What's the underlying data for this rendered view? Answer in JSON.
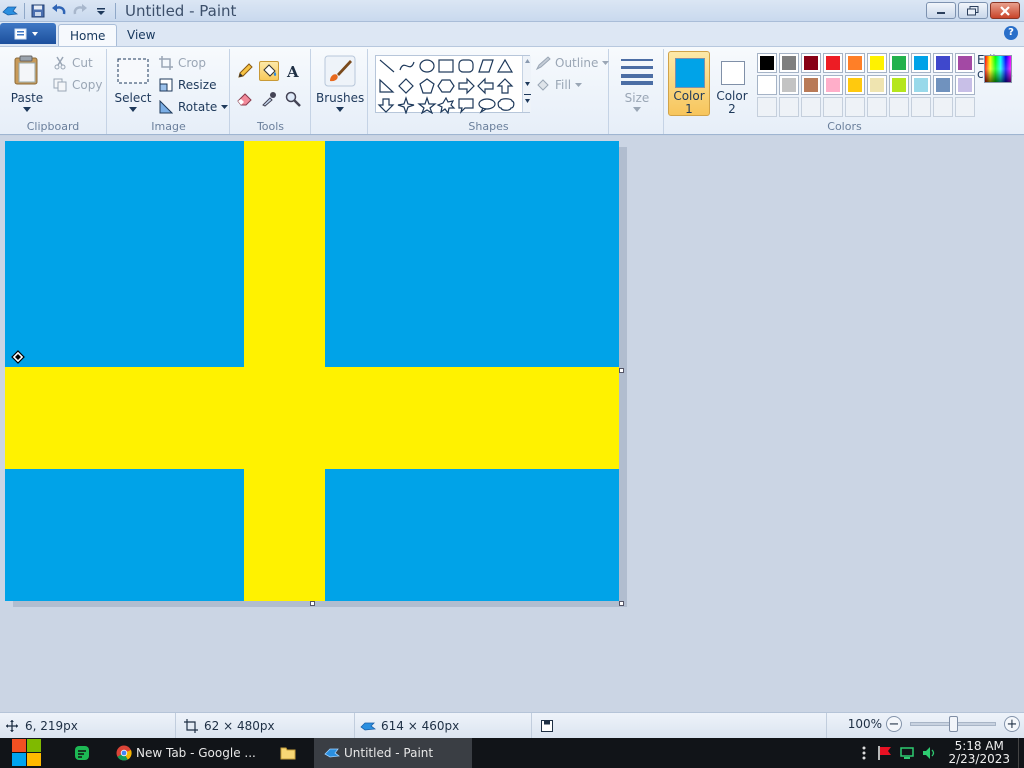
{
  "window": {
    "title": "Untitled - Paint"
  },
  "tabs": [
    {
      "label": "Home"
    },
    {
      "label": "View"
    }
  ],
  "ribbon": {
    "clipboard": {
      "group_label": "Clipboard",
      "paste": "Paste",
      "cut": "Cut",
      "copy": "Copy"
    },
    "image": {
      "group_label": "Image",
      "select": "Select",
      "crop": "Crop",
      "resize": "Resize",
      "rotate": "Rotate"
    },
    "tools": {
      "group_label": "Tools",
      "selected_tool": "fill-with-color"
    },
    "brushes": {
      "label": "Brushes"
    },
    "shapes": {
      "group_label": "Shapes",
      "outline": "Outline",
      "fill": "Fill"
    },
    "size": {
      "label": "Size"
    },
    "colors": {
      "group_label": "Colors",
      "color1_label_line1": "Color",
      "color1_label_line2": "1",
      "color2_label_line1": "Color",
      "color2_label_line2": "2",
      "color1": "#00a3e8",
      "color2": "#ffffff",
      "edit_line1": "Edit",
      "edit_line2": "colors",
      "palette_row1": [
        "#000000",
        "#7f7f7f",
        "#880015",
        "#ed1c24",
        "#ff7f27",
        "#fff200",
        "#22b14c",
        "#00a2e8",
        "#3f48cc",
        "#a349a4"
      ],
      "palette_row2": [
        "#ffffff",
        "#c3c3c3",
        "#b97a57",
        "#ffaec9",
        "#ffc90e",
        "#efe4b0",
        "#b5e61d",
        "#99d9ea",
        "#7092be",
        "#c8bfe7"
      ]
    }
  },
  "canvas": {
    "background": "#00a3e8",
    "cross_color": "#fff200"
  },
  "status": {
    "cursor_pos": "6, 219px",
    "selection_size": "62 × 480px",
    "image_size": "614 × 460px",
    "zoom": "100%"
  },
  "taskbar": {
    "apps": [
      {
        "label": "New Tab - Google ..."
      },
      {
        "label": "Untitled - Paint"
      }
    ],
    "time": "5:18 AM",
    "date": "2/23/2023"
  }
}
